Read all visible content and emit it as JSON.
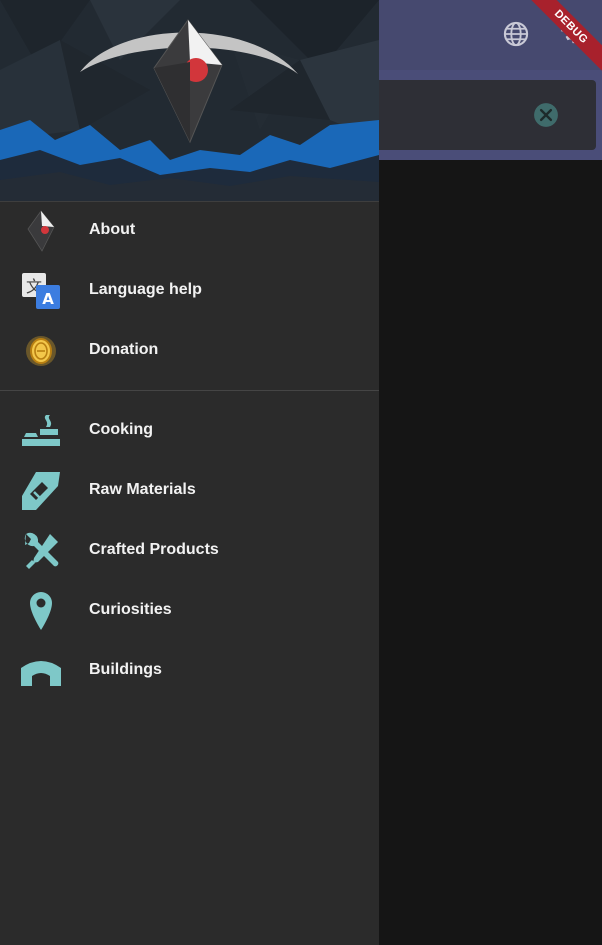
{
  "drawer": {
    "section_primary": [
      {
        "label": "About",
        "icon": "app-logo-icon"
      },
      {
        "label": "Language help",
        "icon": "translate-icon"
      },
      {
        "label": "Donation",
        "icon": "coin-icon"
      }
    ],
    "section_categories": [
      {
        "label": "Cooking",
        "icon": "cooking-icon"
      },
      {
        "label": "Raw Materials",
        "icon": "raw-materials-icon"
      },
      {
        "label": "Crafted Products",
        "icon": "tools-icon"
      },
      {
        "label": "Curiosities",
        "icon": "location-pin-icon"
      },
      {
        "label": "Buildings",
        "icon": "building-icon"
      }
    ]
  },
  "app_bar": {
    "language_icon": "globe-icon",
    "settings_icon": "settings-icon",
    "search_clear_icon": "clear-icon"
  },
  "debug_banner": {
    "label": "DEBUG"
  },
  "colors": {
    "drawer_bg": "#2b2b2b",
    "app_bar": "#46496f",
    "icon_teal": "#7ec8c8",
    "debug_red": "#a8212c"
  }
}
